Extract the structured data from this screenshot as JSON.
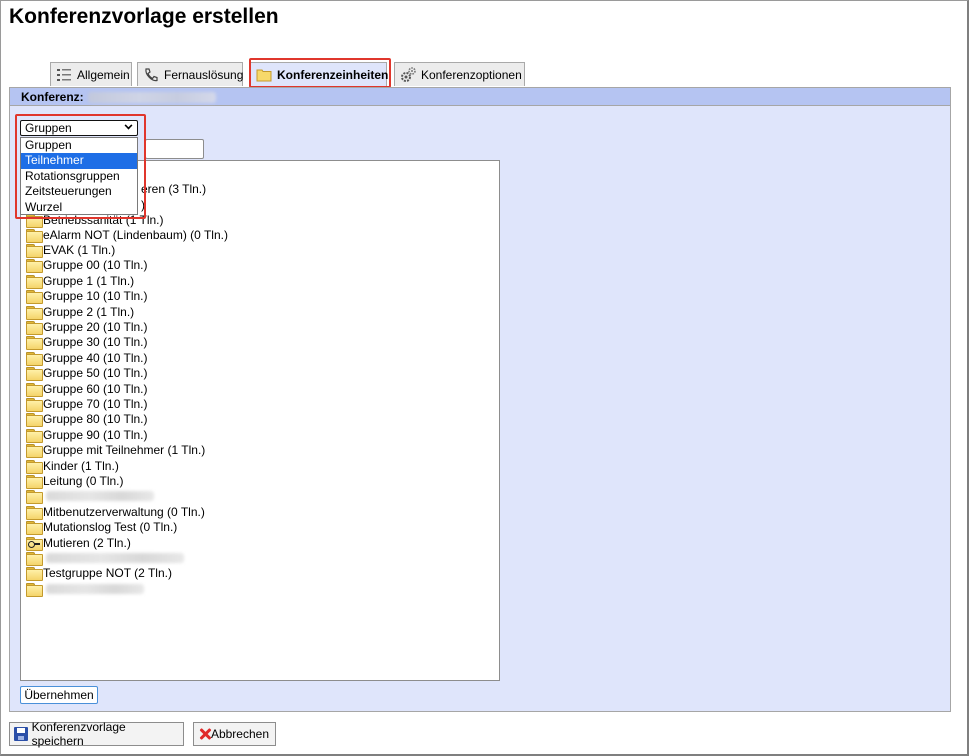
{
  "page": {
    "title": "Konferenzvorlage erstellen"
  },
  "tabs": [
    {
      "label": "Allgemein",
      "icon": "list-icon"
    },
    {
      "label": "Fernauslösung",
      "icon": "phone-icon"
    },
    {
      "label": "Konferenzeinheiten",
      "icon": "folder-icon",
      "active": true
    },
    {
      "label": "Konferenzoptionen",
      "icon": "gears-icon"
    }
  ],
  "panel": {
    "header_label": "Konferenz:"
  },
  "dropdown": {
    "selected": "Gruppen",
    "options": [
      "Gruppen",
      "Teilnehmer",
      "Rotationsgruppen",
      "Zeitsteuerungen",
      "Wurzel"
    ],
    "highlighted_option": "Teilnehmer"
  },
  "tree": {
    "partial_items": [
      "eren (3 Tln.)",
      ")",
      "Betriebssanität (1 Tln.)"
    ],
    "items": [
      "eAlarm NOT (Lindenbaum) (0 Tln.)",
      "EVAK (1 Tln.)",
      "Gruppe 00 (10 Tln.)",
      "Gruppe 1 (1 Tln.)",
      "Gruppe 10 (10 Tln.)",
      "Gruppe 2 (1 Tln.)",
      "Gruppe 20 (10 Tln.)",
      "Gruppe 30 (10 Tln.)",
      "Gruppe 40 (10 Tln.)",
      "Gruppe 50 (10 Tln.)",
      "Gruppe 60 (10 Tln.)",
      "Gruppe 70 (10 Tln.)",
      "Gruppe 80 (10 Tln.)",
      "Gruppe 90 (10 Tln.)",
      "Gruppe mit Teilnehmer (1 Tln.)",
      "Kinder (1 Tln.)",
      "Leitung (0 Tln.)",
      "",
      "Mitbenutzerverwaltung (0 Tln.)",
      "Mutationslog Test (0 Tln.)",
      "Mutieren (2 Tln.)",
      "",
      "Testgruppe NOT (2 Tln.)",
      ""
    ]
  },
  "buttons": {
    "apply": "Übernehmen",
    "save": "Konferenzvorlage speichern",
    "cancel": "Abbrechen"
  },
  "colors": {
    "highlight": "#e0362c",
    "panel_bg": "#dfe5fb",
    "panel_header": "#b5c4f2",
    "selected_option": "#1e6ee6"
  }
}
